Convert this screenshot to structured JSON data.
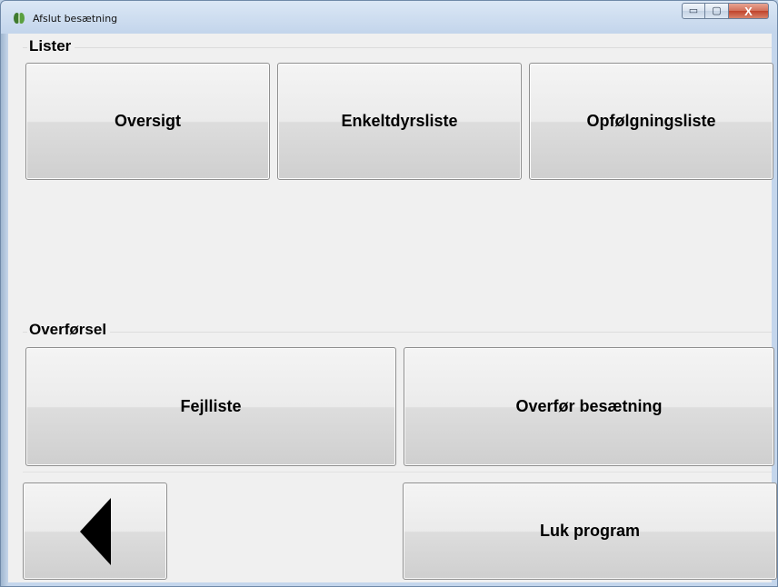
{
  "window": {
    "title": "Afslut besætning",
    "controls": {
      "minimize": "▭",
      "maximize": "▢",
      "close": "X"
    }
  },
  "lister": {
    "label": "Lister",
    "buttons": [
      "Oversigt",
      "Enkeltdyrsliste",
      "Opfølgningsliste"
    ]
  },
  "overforsel": {
    "label": "Overførsel",
    "buttons": [
      "Fejlliste",
      "Overfør besætning"
    ]
  },
  "bottom": {
    "back_icon": "back-arrow-icon",
    "close_label": "Luk program"
  },
  "colors": {
    "client_bg": "#f0f0f0",
    "title_bar": "#c4d6ec",
    "close_button": "#c0432c"
  }
}
